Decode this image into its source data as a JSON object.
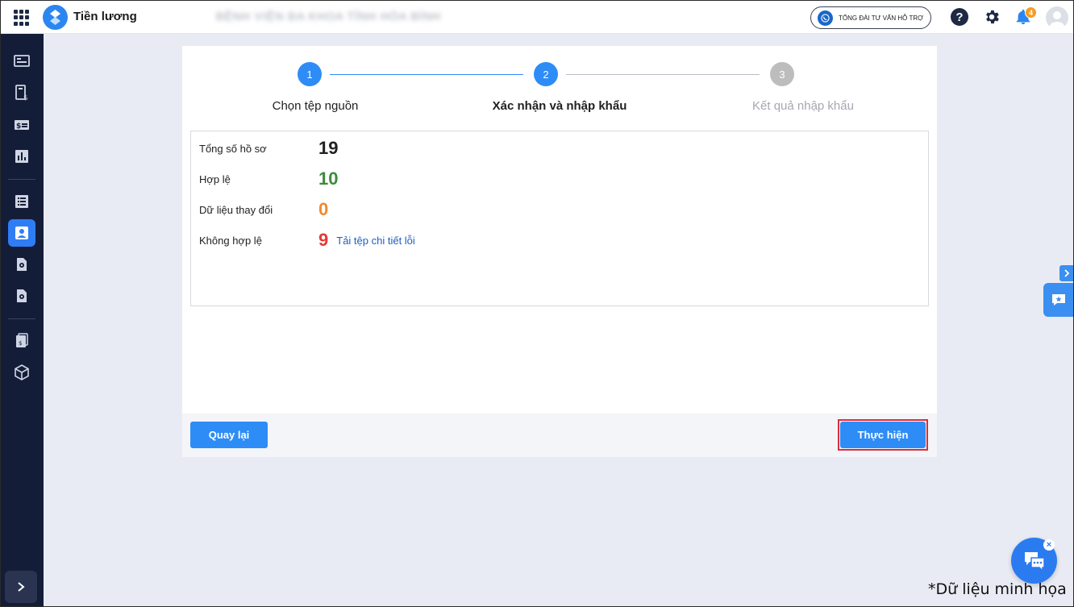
{
  "header": {
    "app_title": "Tiền lương",
    "org_name": "BỆNH VIỆN ĐA KHOA TỈNH HÒA BÌNH",
    "support_label": "TỔNG ĐÀI TƯ VẤN HỖ TRỢ",
    "help_label": "?",
    "notification_count": "4"
  },
  "stepper": {
    "steps": [
      {
        "number": "1",
        "label": "Chọn tệp nguồn",
        "state": "done"
      },
      {
        "number": "2",
        "label": "Xác nhận và nhập khẩu",
        "state": "active"
      },
      {
        "number": "3",
        "label": "Kết quả nhập khẩu",
        "state": "pending"
      }
    ]
  },
  "summary": {
    "total": {
      "label": "Tổng số hồ sơ",
      "value": "19"
    },
    "valid": {
      "label": "Hợp lệ",
      "value": "10"
    },
    "changed": {
      "label": "Dữ liệu thay đổi",
      "value": "0"
    },
    "invalid": {
      "label": "Không hợp lệ",
      "value": "9",
      "link": "Tải tệp chi tiết lỗi"
    }
  },
  "buttons": {
    "back": "Quay lại",
    "execute": "Thực hiện"
  },
  "chat_close": "×",
  "watermark": "*Dữ liệu minh họa",
  "colors": {
    "primary": "#2e8cf6",
    "sidebar": "#141d38",
    "valid": "#3d8b3d",
    "changed": "#ef8a2f",
    "invalid": "#e53935",
    "highlight": "#d9303a"
  }
}
